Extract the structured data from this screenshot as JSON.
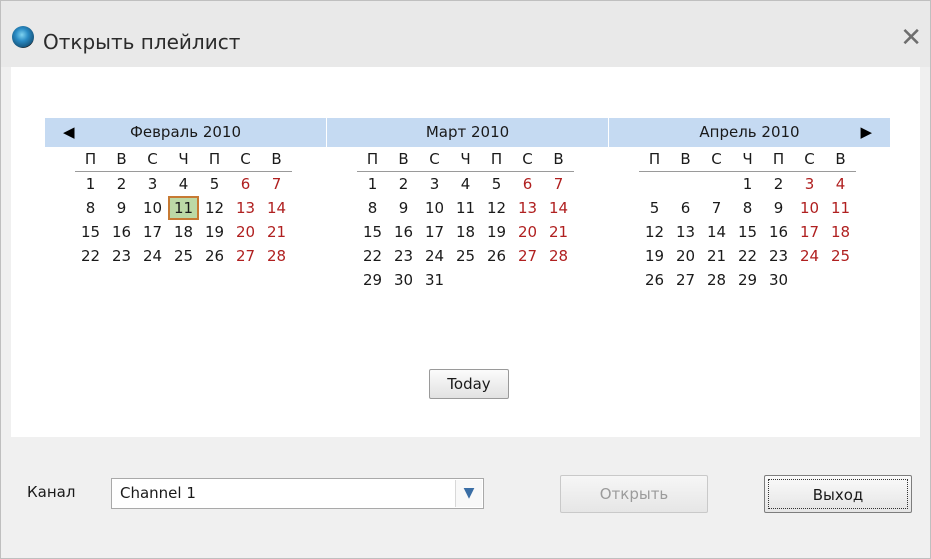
{
  "window": {
    "title": "Открыть плейлист",
    "close_glyph": "✕"
  },
  "calendar": {
    "nav_prev": "◀",
    "nav_next": "▶",
    "weekdays": [
      "П",
      "В",
      "С",
      "Ч",
      "П",
      "С",
      "В"
    ],
    "months": [
      {
        "name": "Февраль 2010",
        "weeks": [
          [
            "1",
            "2",
            "3",
            "4",
            "5",
            "6",
            "7"
          ],
          [
            "8",
            "9",
            "10",
            "11",
            "12",
            "13",
            "14"
          ],
          [
            "15",
            "16",
            "17",
            "18",
            "19",
            "20",
            "21"
          ],
          [
            "22",
            "23",
            "24",
            "25",
            "26",
            "27",
            "28"
          ]
        ],
        "selected_day": "11"
      },
      {
        "name": "Март 2010",
        "weeks": [
          [
            "1",
            "2",
            "3",
            "4",
            "5",
            "6",
            "7"
          ],
          [
            "8",
            "9",
            "10",
            "11",
            "12",
            "13",
            "14"
          ],
          [
            "15",
            "16",
            "17",
            "18",
            "19",
            "20",
            "21"
          ],
          [
            "22",
            "23",
            "24",
            "25",
            "26",
            "27",
            "28"
          ],
          [
            "29",
            "30",
            "31",
            "",
            "",
            "",
            ""
          ]
        ]
      },
      {
        "name": "Апрель 2010",
        "weeks": [
          [
            "",
            "",
            "",
            "1",
            "2",
            "3",
            "4"
          ],
          [
            "5",
            "6",
            "7",
            "8",
            "9",
            "10",
            "11"
          ],
          [
            "12",
            "13",
            "14",
            "15",
            "16",
            "17",
            "18"
          ],
          [
            "19",
            "20",
            "21",
            "22",
            "23",
            "24",
            "25"
          ],
          [
            "26",
            "27",
            "28",
            "29",
            "30",
            "",
            ""
          ]
        ]
      }
    ],
    "today_label": "Today"
  },
  "footer": {
    "channel_label": "Канал",
    "channel_value": "Channel 1",
    "open_label": "Открыть",
    "exit_label": "Выход"
  },
  "colors": {
    "header_bg": "#c5daf2",
    "weekend": "#b02020",
    "selected_bg": "#bcd9a6",
    "selected_border": "#c77a33"
  }
}
